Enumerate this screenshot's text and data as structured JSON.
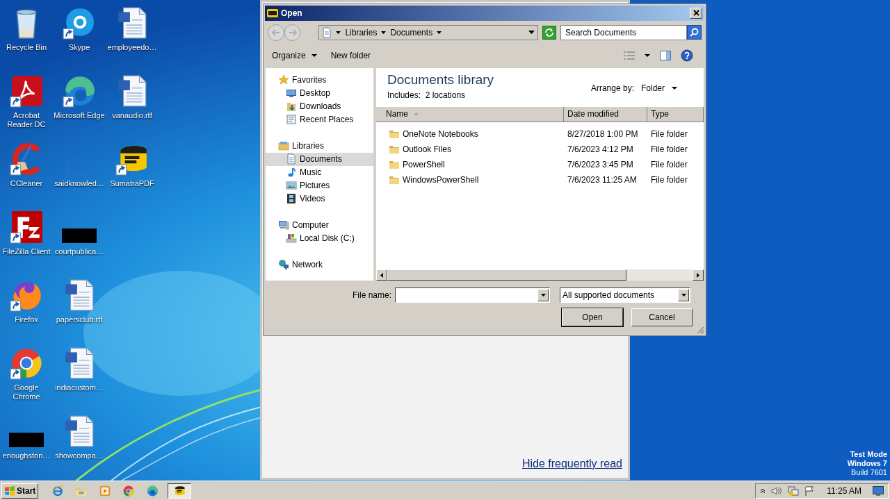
{
  "desktop_icons": [
    {
      "label": "Recycle Bin",
      "kind": "recycle-bin",
      "shortcut": false
    },
    {
      "label": "Acrobat Reader DC",
      "kind": "acrobat",
      "shortcut": true
    },
    {
      "label": "CCleaner",
      "kind": "ccleaner",
      "shortcut": true
    },
    {
      "label": "FileZilla Client",
      "kind": "filezilla",
      "shortcut": true
    },
    {
      "label": "Firefox",
      "kind": "firefox",
      "shortcut": true
    },
    {
      "label": "Google Chrome",
      "kind": "chrome",
      "shortcut": true
    },
    {
      "label": "enoughston…",
      "kind": "redacted",
      "shortcut": false
    },
    {
      "label": "Skype",
      "kind": "skype",
      "shortcut": true
    },
    {
      "label": "Microsoft Edge",
      "kind": "edge",
      "shortcut": true
    },
    {
      "label": "saidknowled…",
      "kind": "blank",
      "shortcut": false
    },
    {
      "label": "courtpublica…",
      "kind": "redacted",
      "shortcut": false
    },
    {
      "label": "papersclub.rtf",
      "kind": "word",
      "shortcut": false
    },
    {
      "label": "indiacustom…",
      "kind": "word",
      "shortcut": false
    },
    {
      "label": "showcompa…",
      "kind": "word",
      "shortcut": false
    },
    {
      "label": "employeedo…",
      "kind": "word",
      "shortcut": false
    },
    {
      "label": "vanaudio.rtf",
      "kind": "word",
      "shortcut": false
    },
    {
      "label": "SumatraPDF",
      "kind": "sumatra",
      "shortcut": true
    }
  ],
  "background_window": {
    "link": "Hide frequently read"
  },
  "dialog": {
    "title": "Open",
    "address": [
      "Libraries",
      "Documents"
    ],
    "search": {
      "placeholder": "Search Documents"
    },
    "toolbar": [
      {
        "label": "Organize",
        "menu": true
      },
      {
        "label": "New folder",
        "menu": false
      }
    ],
    "navigation": [
      {
        "label": "Favorites",
        "kind": "star",
        "selected": false,
        "children": [
          {
            "label": "Desktop",
            "kind": "desktop",
            "selected": false
          },
          {
            "label": "Downloads",
            "kind": "downloads",
            "selected": false
          },
          {
            "label": "Recent Places",
            "kind": "recent",
            "selected": false
          }
        ]
      },
      {
        "label": "Libraries",
        "kind": "library",
        "selected": false,
        "children": [
          {
            "label": "Documents",
            "kind": "documents",
            "selected": true
          },
          {
            "label": "Music",
            "kind": "music",
            "selected": false
          },
          {
            "label": "Pictures",
            "kind": "pictures",
            "selected": false
          },
          {
            "label": "Videos",
            "kind": "videos",
            "selected": false
          }
        ]
      },
      {
        "label": "Computer",
        "kind": "computer",
        "selected": false,
        "children": [
          {
            "label": "Local Disk (C:)",
            "kind": "disk",
            "selected": false
          }
        ]
      },
      {
        "label": "Network",
        "kind": "network",
        "selected": false
      }
    ],
    "library": {
      "title": "Documents library",
      "subtitle": "Includes:  2 locations",
      "arrange_label": "Arrange by:",
      "arrange_value": "Folder"
    },
    "columns": [
      {
        "label": "Name",
        "sorted": true
      },
      {
        "label": "Date modified",
        "sorted": false
      },
      {
        "label": "Type",
        "sorted": false
      }
    ],
    "rows": [
      {
        "name": "OneNote Notebooks",
        "date": "8/27/2018 1:00 PM",
        "type": "File folder"
      },
      {
        "name": "Outlook Files",
        "date": "7/6/2023 4:12 PM",
        "type": "File folder"
      },
      {
        "name": "PowerShell",
        "date": "7/6/2023 3:45 PM",
        "type": "File folder"
      },
      {
        "name": "WindowsPowerShell",
        "date": "7/6/2023 11:25 AM",
        "type": "File folder"
      }
    ],
    "file_name_label": "File name:",
    "file_type": "All supported documents",
    "buttons": [
      {
        "label": "Open",
        "default": true
      },
      {
        "label": "Cancel",
        "default": false
      }
    ]
  },
  "system_notice": [
    {
      "text": "Test Mode",
      "bold": true
    },
    {
      "text": "Windows 7",
      "bold": true
    },
    {
      "text": "Build 7601",
      "bold": false
    }
  ],
  "taskbar": {
    "start": "Start",
    "apps": [
      {
        "kind": "ie",
        "active": false
      },
      {
        "kind": "explorer",
        "active": false
      },
      {
        "kind": "media",
        "active": false
      },
      {
        "kind": "chrome",
        "active": false
      },
      {
        "kind": "edge",
        "active": false
      },
      {
        "kind": "sumatra",
        "active": true
      }
    ],
    "clock": "11:25 AM"
  }
}
